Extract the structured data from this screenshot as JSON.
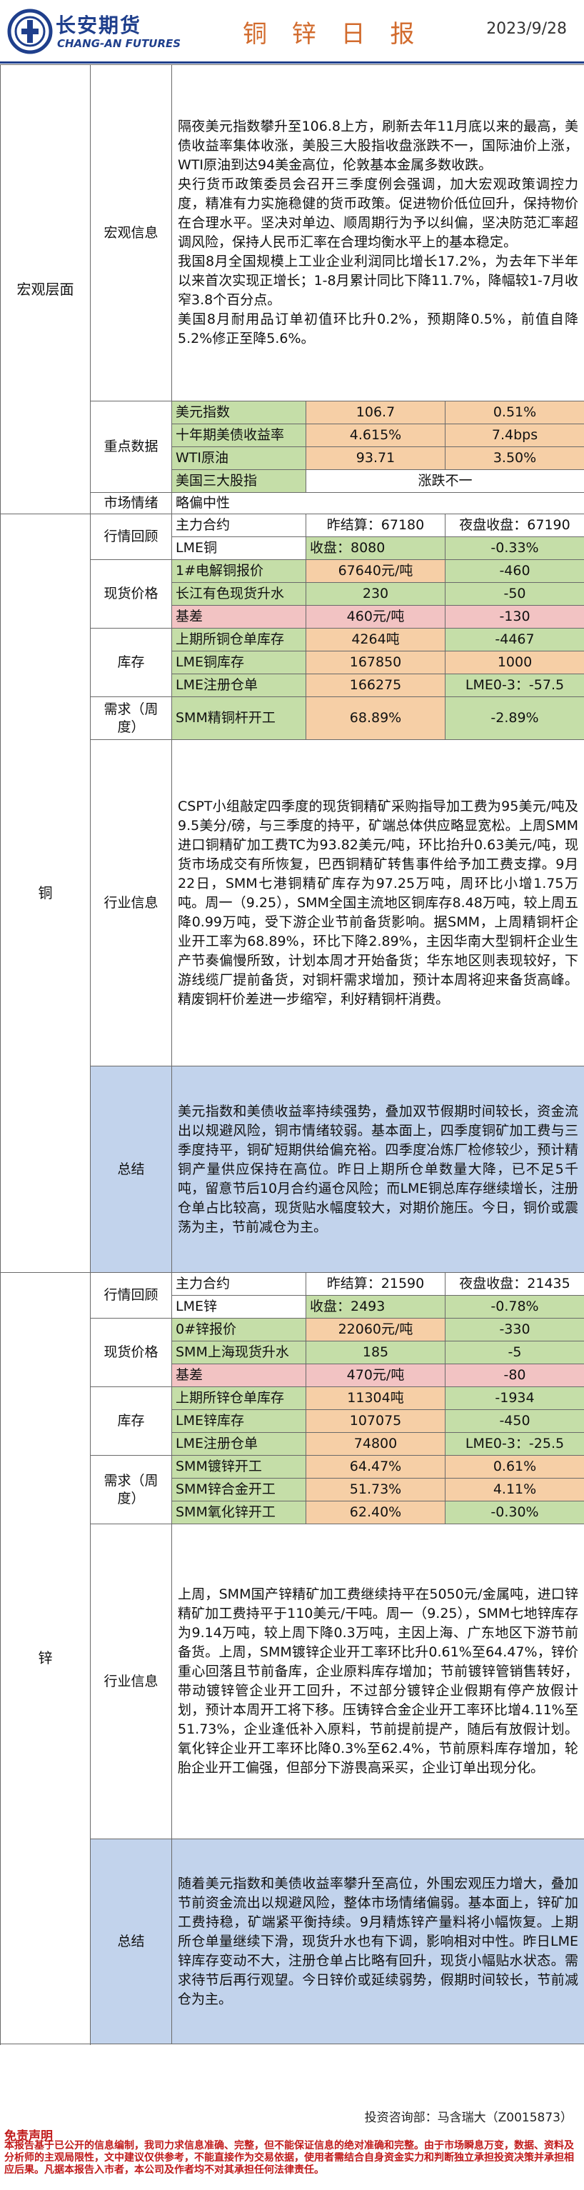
{
  "header": {
    "logo_cn": "长安期货",
    "logo_en": "CHANG-AN FUTURES",
    "title": "铜 锌 日 报",
    "date": "2023/9/28"
  },
  "macro": {
    "section": "宏观层面",
    "info_label": "宏观信息",
    "info_paragraphs": [
      "隔夜美元指数攀升至106.8上方，刷新去年11月底以来的最高，美债收益率集体收涨，美股三大股指收盘涨跌不一，国际油价上涨，WTI原油到达94美金高位，伦敦基本金属多数收跌。",
      "央行货币政策委员会召开三季度例会强调，加大宏观政策调控力度，精准有力实施稳健的货币政策。促进物价低位回升，保持物价在合理水平。坚决对单边、顺周期行为予以纠偏，坚决防范汇率超调风险，保持人民币汇率在合理均衡水平上的基本稳定。",
      "我国8月全国规模上工业企业利润同比增长17.2%，为去年下半年以来首次实现正增长；1-8月累计同比下降11.7%，降幅较1-7月收窄3.8个百分点。",
      "美国8月耐用品订单初值环比升0.2%，预期降0.5%，前值自降5.2%修正至降5.6%。"
    ],
    "key_label": "重点数据",
    "key_rows": [
      {
        "label": "美元指数",
        "v1": "106.7",
        "v2": "0.51%"
      },
      {
        "label": "十年期美债收益率",
        "v1": "4.615%",
        "v2": "7.4bps"
      },
      {
        "label": "WTI原油",
        "v1": "93.71",
        "v2": "3.50%"
      },
      {
        "label": "美国三大股指",
        "v1": "涨跌不一"
      }
    ],
    "sentiment_label": "市场情绪",
    "sentiment_value": "略偏中性"
  },
  "copper": {
    "section": "铜",
    "review_label": "行情回顾",
    "review_rows": [
      {
        "label": "主力合约",
        "v1": "昨结算：67180",
        "v2": "夜盘收盘：67190"
      },
      {
        "label": "LME铜",
        "v1": "收盘：8080",
        "v2": "-0.33%"
      }
    ],
    "spot_label": "现货价格",
    "spot_rows": [
      {
        "label": "1#电解铜报价",
        "v1": "67640元/吨",
        "v2": "-460"
      },
      {
        "label": "长江有色现货升水",
        "v1": "230",
        "v2": "-50"
      },
      {
        "label": "基差",
        "v1": "460元/吨",
        "v2": "-130"
      }
    ],
    "stock_label": "库存",
    "stock_rows": [
      {
        "label": "上期所铜仓单库存",
        "v1": "4264吨",
        "v2": "-4467"
      },
      {
        "label": "LME铜库存",
        "v1": "167850",
        "v2": "1000"
      },
      {
        "label": "LME注册仓单",
        "v1": "166275",
        "v2": "LME0-3：-57.5"
      }
    ],
    "demand_label": "需求（周度）",
    "demand_rows": [
      {
        "label": "SMM精铜杆开工",
        "v1": "68.89%",
        "v2": "-2.89%"
      }
    ],
    "industry_label": "行业信息",
    "industry_text": "CSPT小组敲定四季度的现货铜精矿采购指导加工费为95美元/吨及9.5美分/磅，与三季度的持平，矿端总体供应略显宽松。上周SMM进口铜精矿加工费TC为93.82美元/吨，环比抬升0.63美元/吨，现货市场成交有所恢复，巴西铜精矿转售事件给予加工费支撑。9月22日，SMM七港铜精矿库存为97.25万吨，周环比小增1.75万吨。周一（9.25），SMM全国主流地区铜库存8.48万吨，较上周五降0.99万吨，受下游企业节前备货影响。据SMM，上周精铜杆企业开工率为68.89%，环比下降2.89%，主因华南大型铜杆企业生产节奏偏慢所致，计划本周才开始备货；华东地区则表现较好，下游线缆厂提前备货，对铜杆需求增加，预计本周将迎来备货高峰。精废铜杆价差进一步缩窄，利好精铜杆消费。",
    "summary_label": "总结",
    "summary_text": "美元指数和美债收益率持续强势，叠加双节假期时间较长，资金流出以规避风险，铜市情绪较弱。基本面上，四季度铜矿加工费与三季度持平，铜矿短期供给偏充裕。四季度冶炼厂检修较少，预计精铜产量供应保持在高位。昨日上期所仓单数量大降，已不足5千吨，留意节后10月合约逼仓风险；而LME铜总库存继续增长，注册仓单占比较高，现货贴水幅度较大，对期价施压。今日，铜价或震荡为主，节前减仓为主。"
  },
  "zinc": {
    "section": "锌",
    "review_label": "行情回顾",
    "review_rows": [
      {
        "label": "主力合约",
        "v1": "昨结算：21590",
        "v2": "夜盘收盘：21435"
      },
      {
        "label": "LME锌",
        "v1": "收盘：2493",
        "v2": "-0.78%"
      }
    ],
    "spot_label": "现货价格",
    "spot_rows": [
      {
        "label": "0#锌报价",
        "v1": "22060元/吨",
        "v2": "-330"
      },
      {
        "label": "SMM上海现货升水",
        "v1": "185",
        "v2": "-5"
      },
      {
        "label": "基差",
        "v1": "470元/吨",
        "v2": "-80"
      }
    ],
    "stock_label": "库存",
    "stock_rows": [
      {
        "label": "上期所锌仓单库存",
        "v1": "11304吨",
        "v2": "-1934"
      },
      {
        "label": "LME锌库存",
        "v1": "107075",
        "v2": "-450"
      },
      {
        "label": "LME注册仓单",
        "v1": "74800",
        "v2": "LME0-3：-25.5"
      }
    ],
    "demand_label": "需求（周度）",
    "demand_rows": [
      {
        "label": "SMM镀锌开工",
        "v1": "64.47%",
        "v2": "0.61%"
      },
      {
        "label": "SMM锌合金开工",
        "v1": "51.73%",
        "v2": "4.11%"
      },
      {
        "label": "SMM氧化锌开工",
        "v1": "62.40%",
        "v2": "-0.30%"
      }
    ],
    "industry_label": "行业信息",
    "industry_text": "上周，SMM国产锌精矿加工费继续持平在5050元/金属吨，进口锌精矿加工费持平于110美元/干吨。周一（9.25），SMM七地锌库存为9.14万吨，较上周下降0.3万吨，主因上海、广东地区下游节前备货。上周，SMM镀锌企业开工率环比升0.61%至64.47%，锌价重心回落且节前备库，企业原料库存增加；节前镀锌管销售转好，带动镀锌管企业开工回升，不过部分镀锌企业假期有停产放假计划，预计本周开工将下移。压铸锌合金企业开工率环比增4.11%至51.73%，企业逢低补入原料，节前提前提产，随后有放假计划。氧化锌企业开工率环比降0.3%至62.4%，节前原料库存增加，轮胎企业开工偏强，但部分下游畏高采买，企业订单出现分化。",
    "summary_label": "总结",
    "summary_text": "随着美元指数和美债收益率攀升至高位，外围宏观压力增大，叠加节前资金流出以规避风险，整体市场情绪偏弱。基本面上，锌矿加工费持稳，矿端紧平衡持续。9月精炼锌产量料将小幅恢复。上期所仓单量继续下滑，现货升水也有下调，影响相对中性。昨日LME锌库存变动不大，注册仓单占比略有回升，现货小幅贴水状态。需求待节后再行观望。今日锌价或延续弱势，假期时间较长，节前减仓为主。"
  },
  "footer": {
    "advisor": "投资咨询部：马含瑞大（Z0015873）",
    "disclaimer_title": "免责声明",
    "disclaimer_text": "本报告基于已公开的信息编制，我司力求信息准确、完整，但不能保证信息的绝对准确和完整。由于市场瞬息万变，数据、资料及分析师的主观局限性，文中建议仅供参考，不能直接作为交易依据，使用者需结合自身资金实力和判断独立承担投资决策并承担相应后果。凡据本报告入市者，本公司及作者均不对其承担任何法律责任。"
  },
  "colors": {
    "brand": "#1f3f8c",
    "title": "#d26b2d",
    "green": "#c5dea8",
    "orange": "#f6cfa6",
    "pink": "#f2c3c3",
    "blue": "#c2d3ec",
    "disclaimer": "#c11b1b"
  }
}
